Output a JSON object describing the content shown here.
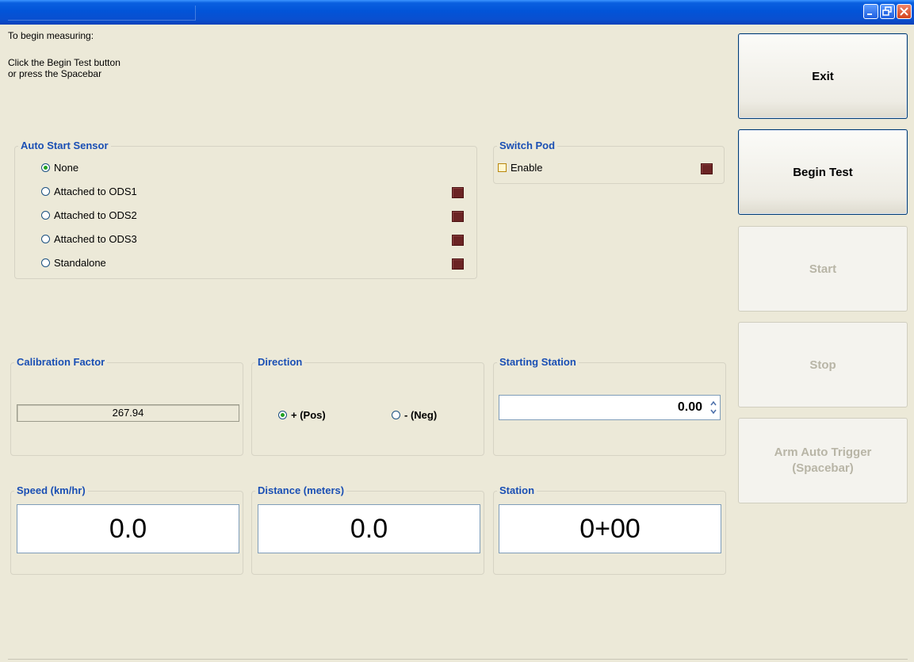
{
  "window": {
    "title": ""
  },
  "instructions": {
    "line1": "To begin measuring:",
    "line2": "Click the Begin Test button",
    "line3": "or press the Spacebar"
  },
  "auto_start_sensor": {
    "title": "Auto Start Sensor",
    "options": [
      {
        "label": "None",
        "checked": true
      },
      {
        "label": "Attached to ODS1",
        "checked": false
      },
      {
        "label": "Attached to ODS2",
        "checked": false
      },
      {
        "label": "Attached to ODS3",
        "checked": false
      },
      {
        "label": "Standalone",
        "checked": false
      }
    ]
  },
  "switch_pod": {
    "title": "Switch Pod",
    "enable_label": "Enable",
    "enabled": false
  },
  "calibration": {
    "title": "Calibration Factor",
    "value": "267.94"
  },
  "direction": {
    "title": "Direction",
    "pos_label": "+ (Pos)",
    "neg_label": "- (Neg)",
    "selected": "pos"
  },
  "starting_station": {
    "title": "Starting Station",
    "value": "0.00"
  },
  "speed": {
    "title": "Speed (km/hr)",
    "value": "0.0"
  },
  "distance": {
    "title": "Distance  (meters)",
    "value": "0.0"
  },
  "station": {
    "title": "Station",
    "value": "0+00"
  },
  "buttons": {
    "exit": "Exit",
    "begin_test": "Begin Test",
    "start": "Start",
    "stop": "Stop",
    "arm_line1": "Arm Auto Trigger",
    "arm_line2": "(Spacebar)"
  },
  "colors": {
    "background": "#ece9d8",
    "group_title": "#1a4fb4",
    "led": "#6b2424",
    "titlebar": "#0254d8"
  }
}
